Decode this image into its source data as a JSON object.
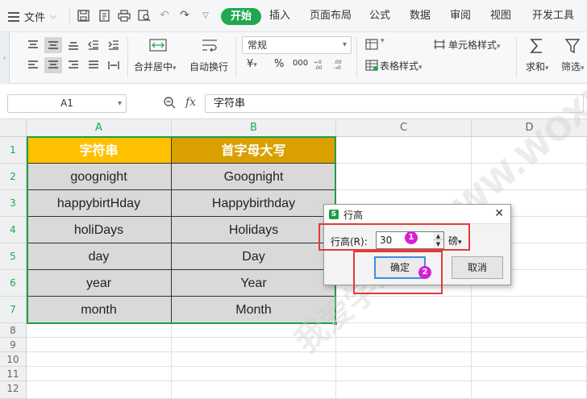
{
  "menubar": {
    "file_label": "文件",
    "tabs": [
      {
        "label": "开始",
        "active": true
      },
      {
        "label": "插入"
      },
      {
        "label": "页面布局"
      },
      {
        "label": "公式"
      },
      {
        "label": "数据"
      },
      {
        "label": "审阅"
      },
      {
        "label": "视图"
      },
      {
        "label": "开发工具"
      }
    ]
  },
  "ribbon": {
    "merge_label": "合并居中",
    "merge_arrow": "▾",
    "wrap_label": "自动换行",
    "number_format": "常规",
    "currency_symbol": "¥",
    "currency_arrow": "▾",
    "percent_symbol": "%",
    "thousands_symbol": "000",
    "cell_format_label": "单元格样式",
    "cell_format_arrow": "▾",
    "table_style_label": "表格样式",
    "table_style_arrow": "▾",
    "sum_label": "求和",
    "sum_arrow": "▾",
    "filter_label": "筛选",
    "filter_arrow": "▾"
  },
  "formula_bar": {
    "name_box": "A1",
    "fx_label": "fx",
    "content": "字符串"
  },
  "grid": {
    "columns": [
      "A",
      "B",
      "C",
      "D"
    ],
    "rows": [
      "1",
      "2",
      "3",
      "4",
      "5",
      "6",
      "7",
      "8",
      "9",
      "10",
      "11",
      "12"
    ],
    "header": [
      "字符串",
      "首字母大写"
    ],
    "data": [
      [
        "goognight",
        "Goognight"
      ],
      [
        "happybirtHday",
        "Happybirthday"
      ],
      [
        "holiDays",
        "Holidays"
      ],
      [
        "day",
        "Day"
      ],
      [
        "year",
        "Year"
      ],
      [
        "month",
        "Month"
      ]
    ],
    "header_colors": [
      "#ffc000",
      "#d9a000"
    ],
    "selection_color": "#1f9e47"
  },
  "watermark": "我爱学习网 WWW.WOXIXIN.COM",
  "dialog": {
    "title": "行高",
    "logo": "S",
    "close": "✕",
    "label": "行高(R):",
    "value": "30",
    "unit": "磅",
    "unit_arrow": "▾",
    "ok_label": "确定",
    "cancel_label": "取消",
    "badge_1": "1",
    "badge_2": "2"
  }
}
